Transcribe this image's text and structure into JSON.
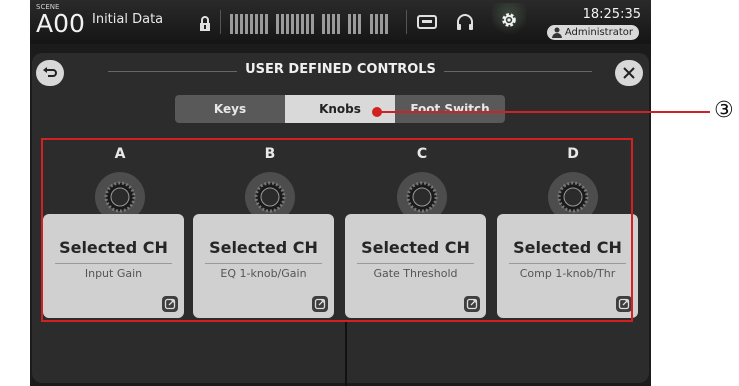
{
  "status_bar": {
    "scene_label": "SCENE",
    "scene_number": "A00",
    "scene_name": "Initial Data",
    "time": "18:25:35",
    "user": "Administrator"
  },
  "window": {
    "title": "USER DEFINED CONTROLS",
    "back_icon": "back-arrow-icon",
    "close_label": "×"
  },
  "tabs": [
    {
      "label": "Keys",
      "selected": false
    },
    {
      "label": "Knobs",
      "selected": true
    },
    {
      "label": "Foot Switch",
      "selected": false
    }
  ],
  "controls": [
    {
      "letter": "A",
      "title": "Selected CH",
      "parameter": "Input Gain"
    },
    {
      "letter": "B",
      "title": "Selected CH",
      "parameter": "EQ 1-knob/Gain"
    },
    {
      "letter": "C",
      "title": "Selected CH",
      "parameter": "Gate Threshold"
    },
    {
      "letter": "D",
      "title": "Selected CH",
      "parameter": "Comp 1-knob/Thr"
    }
  ],
  "annotation": {
    "callout_number": "③",
    "color": "#d32020"
  }
}
